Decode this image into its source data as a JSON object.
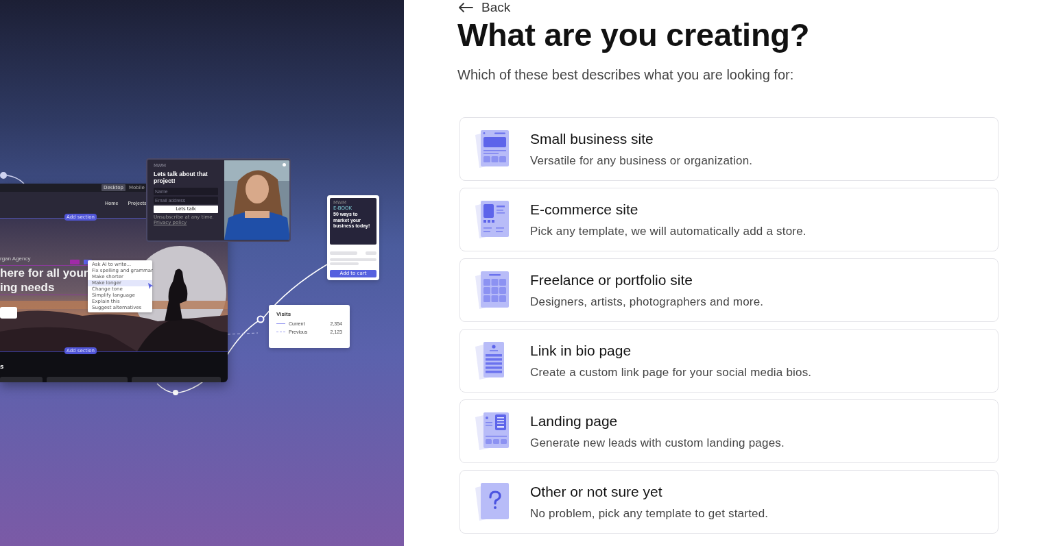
{
  "illustration": {
    "editor": {
      "view_toggle": [
        {
          "label": "Desktop",
          "selected": true
        },
        {
          "label": "Mobile",
          "selected": false
        }
      ],
      "nav": [
        "Home",
        "Projects"
      ],
      "add_section": [
        "Add section",
        "Add section"
      ],
      "brand": "rgan Agency",
      "headline": "here for all your\ning needs",
      "ai_menu": [
        {
          "label": "Ask AI to write...",
          "selected": false
        },
        {
          "label": "Fix spelling and grammar",
          "selected": false
        },
        {
          "label": "Make shorter",
          "selected": false
        },
        {
          "label": "Make longer",
          "selected": true
        },
        {
          "label": "Change tone",
          "selected": false
        },
        {
          "label": "Simplify language",
          "selected": false
        },
        {
          "label": "Explain this",
          "selected": false
        },
        {
          "label": "Suggest alternatives",
          "selected": false
        }
      ],
      "section_title": "s"
    },
    "popup": {
      "logo": "MWM",
      "heading": "Lets talk about that project!",
      "name_placeholder": "Name",
      "email_placeholder": "Email address",
      "button": "Lets talk",
      "footnote": "Unsubscribe at any time.",
      "footnote_link": "Privacy policy"
    },
    "ebook": {
      "brand": "MWM",
      "label": "E-BOOK",
      "title": "50 ways to market your business today!",
      "button": "Add to cart"
    },
    "visits": {
      "title": "Visits",
      "rows": [
        {
          "kind": "solid",
          "label": "Current",
          "value": "2,354"
        },
        {
          "kind": "dashed",
          "label": "Previous",
          "value": "2,123"
        }
      ]
    }
  },
  "back": "Back",
  "title": "What are you creating?",
  "subtitle": "Which of these best describes what you are looking for:",
  "options": [
    {
      "kind": "site",
      "title": "Small business site",
      "description": "Versatile for any business or organization."
    },
    {
      "kind": "store",
      "title": "E-commerce site",
      "description": "Pick any template, we will automatically add a store."
    },
    {
      "kind": "grid",
      "title": "Freelance or portfolio site",
      "description": "Designers, artists, photographers and more."
    },
    {
      "kind": "bio",
      "title": "Link in bio page",
      "description": "Create a custom link page for your social media bios."
    },
    {
      "kind": "landing",
      "title": "Landing page",
      "description": "Generate new leads with custom landing pages."
    },
    {
      "kind": "question",
      "title": "Other or not sure yet",
      "description": "No problem, pick any template to get started."
    }
  ]
}
